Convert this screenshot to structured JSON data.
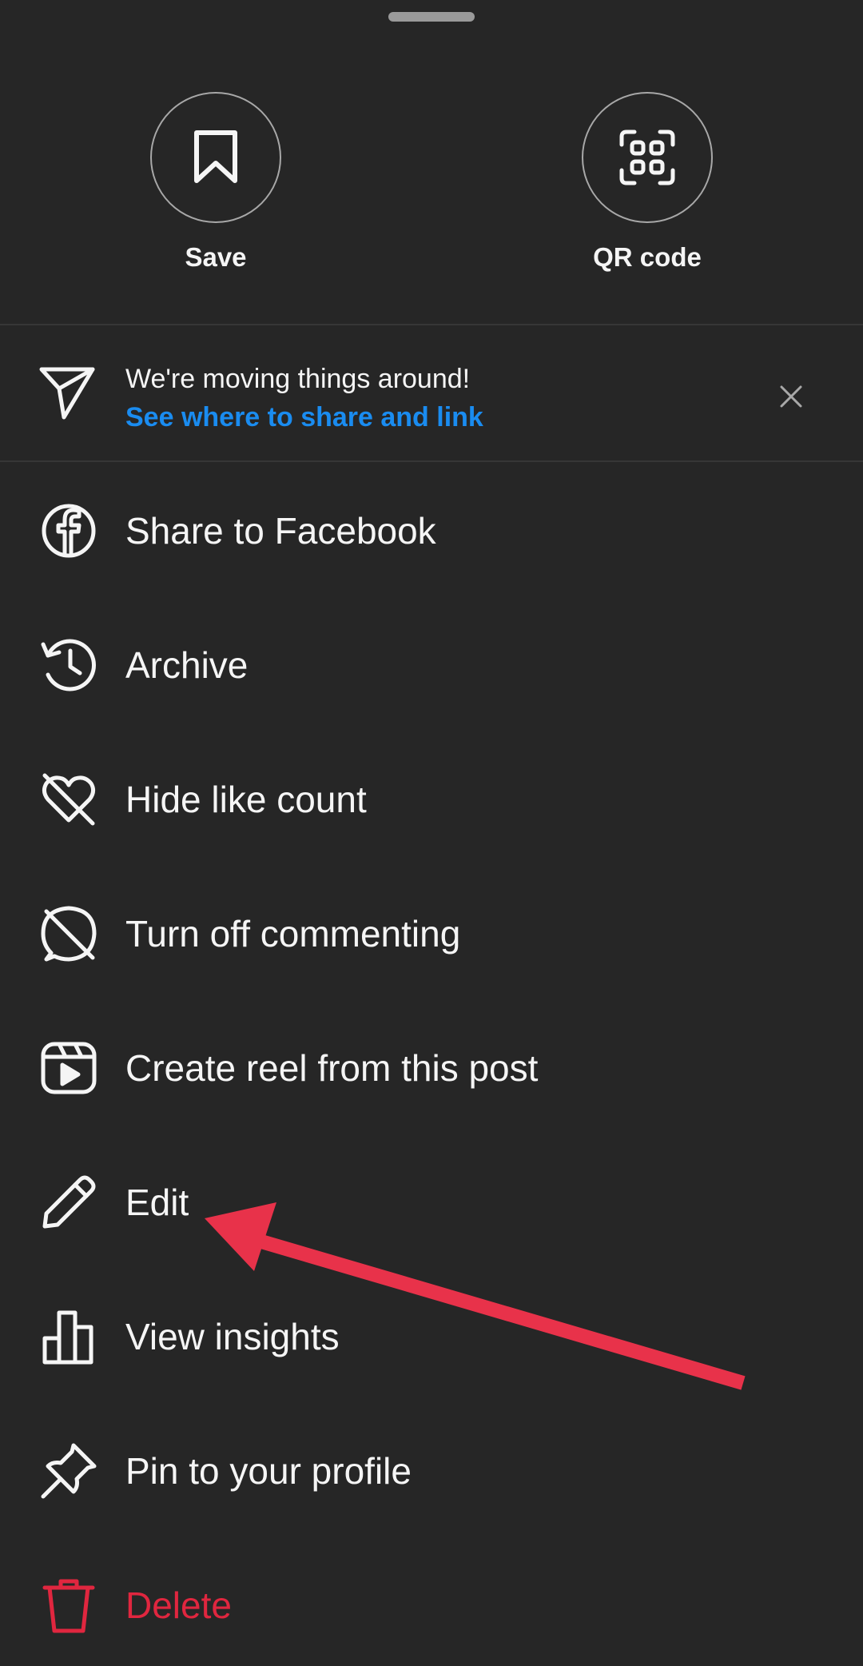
{
  "top_actions": {
    "save": {
      "label": "Save",
      "icon": "bookmark-icon"
    },
    "qr": {
      "label": "QR code",
      "icon": "qr-code-icon"
    }
  },
  "notice": {
    "title": "We're moving things around!",
    "link": "See where to share and link",
    "icon": "paper-plane-icon",
    "close_icon": "close-icon",
    "link_color": "#1a8cf0"
  },
  "menu": {
    "items": [
      {
        "label": "Share to Facebook",
        "icon": "facebook-icon"
      },
      {
        "label": "Archive",
        "icon": "archive-history-icon"
      },
      {
        "label": "Hide like count",
        "icon": "heart-off-icon"
      },
      {
        "label": "Turn off commenting",
        "icon": "comment-off-icon"
      },
      {
        "label": "Create reel from this post",
        "icon": "reel-icon"
      },
      {
        "label": "Edit",
        "icon": "pencil-icon"
      },
      {
        "label": "View insights",
        "icon": "bar-chart-icon"
      },
      {
        "label": "Pin to your profile",
        "icon": "pin-icon"
      },
      {
        "label": "Delete",
        "icon": "trash-icon",
        "color": "#e0263f"
      }
    ]
  },
  "colors": {
    "background": "#262626",
    "text": "#f5f5f5",
    "danger": "#e0263f",
    "annotation_arrow": "#e8324a"
  }
}
